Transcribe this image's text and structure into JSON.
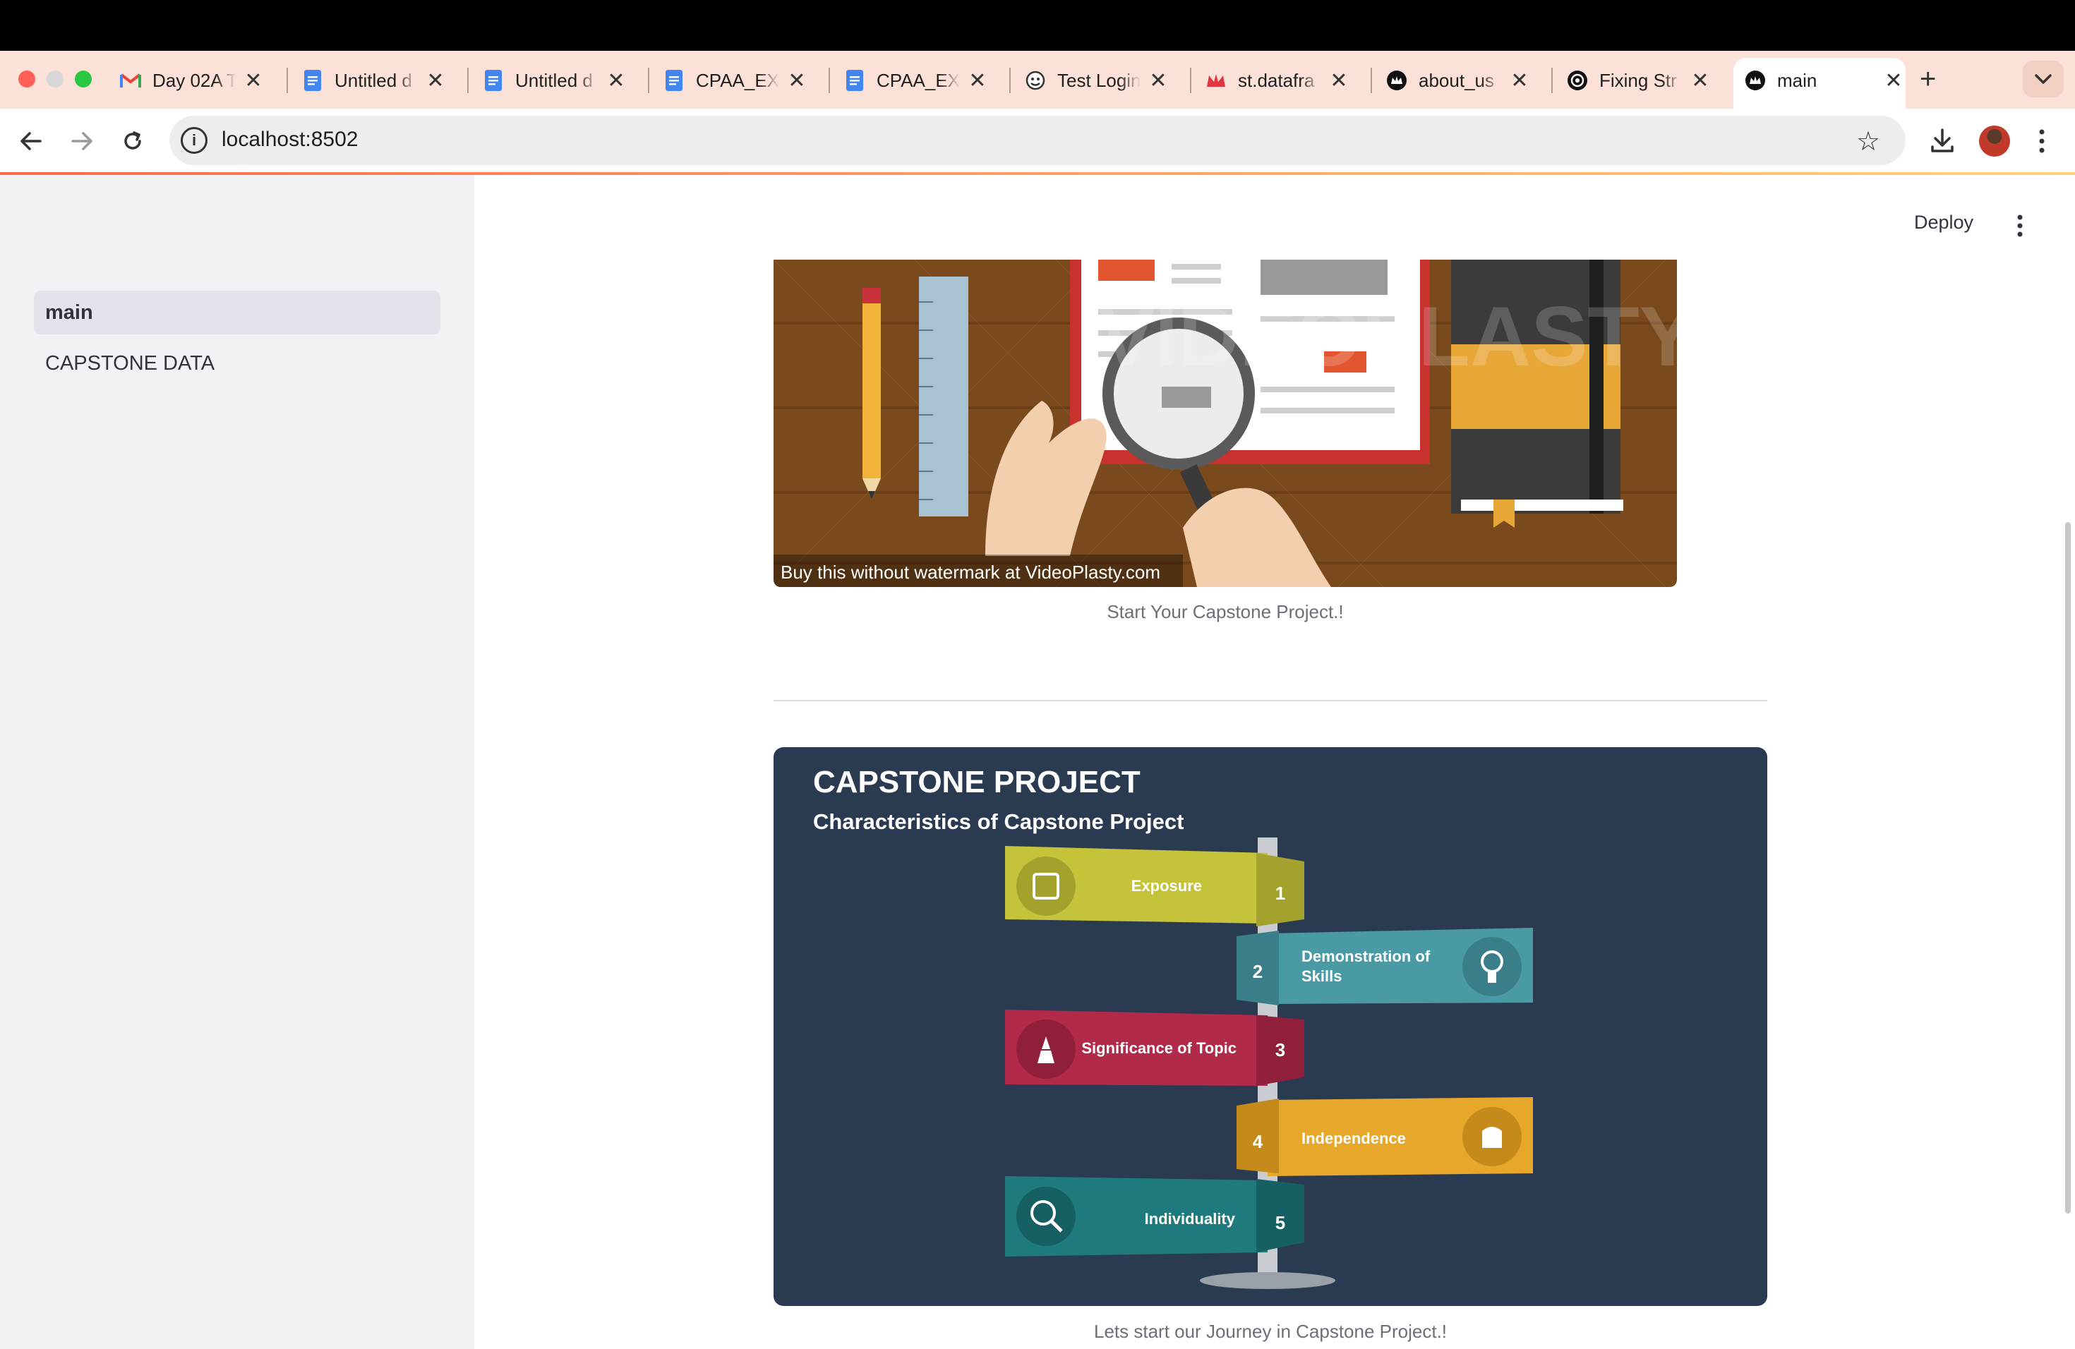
{
  "browser": {
    "tabs": [
      {
        "label": "Day 02A T",
        "icon": "gmail-icon"
      },
      {
        "label": "Untitled d",
        "icon": "docs-icon"
      },
      {
        "label": "Untitled d",
        "icon": "docs-icon"
      },
      {
        "label": "CPAA_EXI",
        "icon": "docs-icon"
      },
      {
        "label": "CPAA_EXI",
        "icon": "docs-icon"
      },
      {
        "label": "Test Login",
        "icon": "face-icon"
      },
      {
        "label": "st.datafra",
        "icon": "streamlit-crown-icon"
      },
      {
        "label": "about_us",
        "icon": "streamlit-app-icon"
      },
      {
        "label": "Fixing Str",
        "icon": "openai-icon"
      },
      {
        "label": "main",
        "icon": "streamlit-app-icon",
        "active": true
      }
    ],
    "url": "localhost:8502",
    "close_glyph": "✕",
    "new_tab_glyph": "+"
  },
  "sidebar": {
    "items": [
      {
        "label": "main",
        "active": true
      },
      {
        "label": "CAPSTONE DATA",
        "active": false
      }
    ]
  },
  "header": {
    "deploy_label": "Deploy"
  },
  "main": {
    "image1": {
      "watermark_text": "Buy this without watermark at VideoPlasty.com",
      "caption": "Start Your Capstone Project.!"
    },
    "image2": {
      "title": "CAPSTONE PROJECT",
      "subtitle": "Characteristics of Capstone Project",
      "signs": [
        {
          "number": "1",
          "label": "Exposure",
          "color": "#c4c33a"
        },
        {
          "number": "2",
          "label1": "Demonstration of",
          "label2": "Skills",
          "color": "#4a9aa6"
        },
        {
          "number": "3",
          "label": "Significance of Topic",
          "color": "#b22a4a"
        },
        {
          "number": "4",
          "label": "Independence",
          "color": "#e6a72b"
        },
        {
          "number": "5",
          "label": "Individuality",
          "color": "#1f7a7e"
        }
      ],
      "caption": "Lets start our Journey in Capstone Project.!"
    }
  },
  "colors": {
    "sidebar_bg": "#f0f2f6",
    "panel_bg": "#2a3a50",
    "accent_gradient_start": "#ff6b4a"
  }
}
